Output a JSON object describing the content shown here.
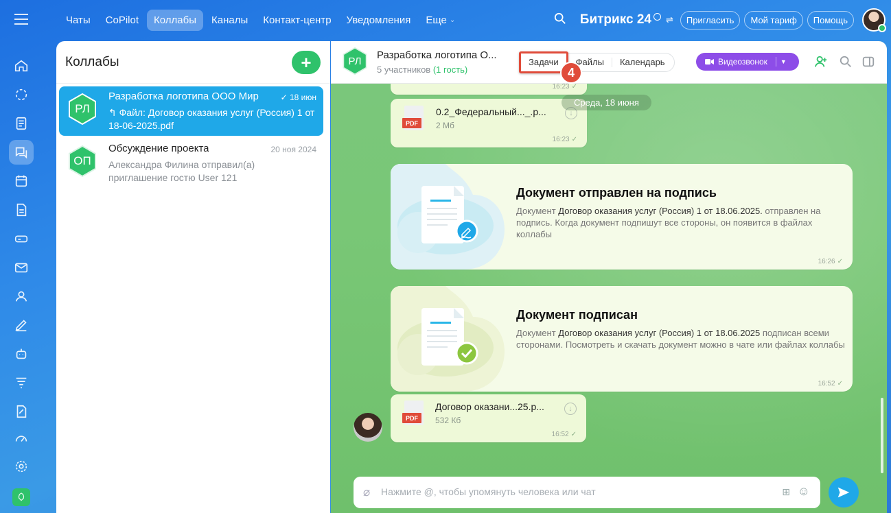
{
  "nav": {
    "tabs": [
      "Чаты",
      "CoPilot",
      "Коллабы",
      "Каналы",
      "Контакт-центр",
      "Уведомления"
    ],
    "more_label": "Еще",
    "brand": "Битрикс 24",
    "invite": "Пригласить",
    "tariff": "Мой тариф",
    "help": "Помощь"
  },
  "list": {
    "title": "Коллабы",
    "add_label": "+",
    "items": [
      {
        "initials": "РЛ",
        "name": "Разработка логотипа ООО Мир",
        "date": "18 июн",
        "preview": "↰ Файл: Договор оказания услуг (Россия) 1 от 18-06-2025.pdf"
      },
      {
        "initials": "ОП",
        "name": "Обсуждение проекта",
        "date": "20 ноя 2024",
        "preview": "Александра Филина отправил(а) приглашение гостю User 121"
      }
    ]
  },
  "chat": {
    "initials": "РЛ",
    "title": "Разработка логотипа О...",
    "members": "5 участников",
    "guest": "(1 гость)",
    "tabs": [
      "Задачи",
      "Файлы",
      "Календарь"
    ],
    "step_badge": "4",
    "video_label": "Видеозвонок",
    "date_separator": "Среда, 18 июня",
    "messages": {
      "top_time": "16:23",
      "file1": {
        "icon_label": "PDF",
        "name": "0.2_Федеральный..._.p...",
        "size": "2 Мб",
        "time": "16:23"
      },
      "card1": {
        "title": "Документ отправлен на подпись",
        "text_prefix": "Документ",
        "doc": "Договор оказания услуг (Россия) 1 от 18.06.2025.",
        "text_suffix": "отправлен на подпись. Когда документ подпишут все стороны, он появится в файлах коллабы",
        "time": "16:26"
      },
      "card2": {
        "title": "Документ подписан",
        "text_prefix": "Документ",
        "doc": "Договор оказания услуг (Россия) 1 от 18.06.2025",
        "text_suffix": "подписан всеми сторонами. Посмотреть и скачать документ можно в чате или файлах коллабы",
        "time": "16:52"
      },
      "file2": {
        "icon_label": "PDF",
        "name": "Договор оказани...25.p...",
        "size": "532 Кб",
        "time": "16:52"
      }
    },
    "composer_placeholder": "Нажмите @, чтобы упомянуть человека или чат"
  },
  "colors": {
    "accent_green": "#2fc26b",
    "selected_blue": "#1fa8e8",
    "video_purple": "#8d4de8",
    "highlight_red": "#e04b3a"
  }
}
